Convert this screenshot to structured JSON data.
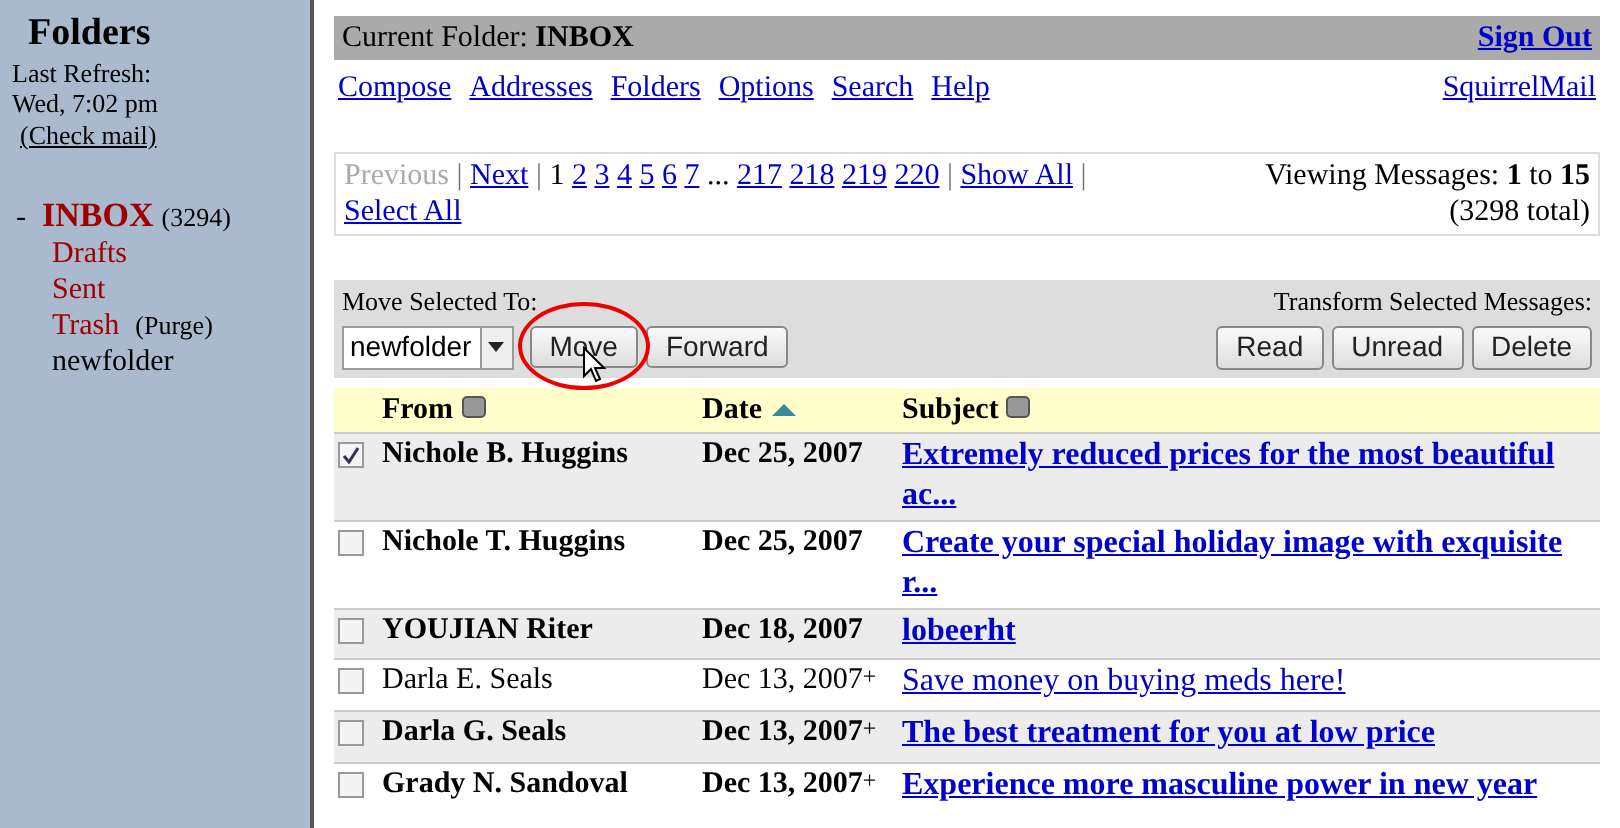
{
  "sidebar": {
    "title": "Folders",
    "refresh_label": "Last Refresh:",
    "refresh_time": "Wed, 7:02 pm",
    "check_mail": "(Check mail)",
    "folders": [
      {
        "expander": "-",
        "label": "INBOX",
        "count": "(3294)",
        "kind": "special",
        "selected": true
      },
      {
        "label": "Drafts",
        "kind": "special",
        "selected": false
      },
      {
        "label": "Sent",
        "kind": "special",
        "selected": false
      },
      {
        "label": "Trash",
        "action": "(Purge)",
        "kind": "special",
        "selected": false
      },
      {
        "label": "newfolder",
        "kind": "normal",
        "selected": false
      }
    ]
  },
  "header": {
    "folder_label": "Current Folder:",
    "folder": "INBOX",
    "sign_out": "Sign Out"
  },
  "nav": {
    "links": [
      "Compose",
      "Addresses",
      "Folders",
      "Options",
      "Search",
      "Help"
    ],
    "brand": "SquirrelMail"
  },
  "pager": {
    "items": [
      {
        "kind": "disabled",
        "text": "Previous"
      },
      {
        "kind": "sep",
        "text": "|"
      },
      {
        "kind": "link",
        "text": "Next"
      },
      {
        "kind": "sep",
        "text": "|"
      },
      {
        "kind": "current",
        "text": "1"
      },
      {
        "kind": "link",
        "text": "2"
      },
      {
        "kind": "link",
        "text": "3"
      },
      {
        "kind": "link",
        "text": "4"
      },
      {
        "kind": "link",
        "text": "5"
      },
      {
        "kind": "link",
        "text": "6"
      },
      {
        "kind": "link",
        "text": "7"
      },
      {
        "kind": "plain",
        "text": "..."
      },
      {
        "kind": "link",
        "text": "217"
      },
      {
        "kind": "link",
        "text": "218"
      },
      {
        "kind": "link",
        "text": "219"
      },
      {
        "kind": "link",
        "text": "220"
      },
      {
        "kind": "sep",
        "text": "|"
      },
      {
        "kind": "link",
        "text": "Show All"
      },
      {
        "kind": "sep",
        "text": "|"
      },
      {
        "kind": "link",
        "text": "Select All"
      }
    ],
    "viewing": "Viewing Messages: **1** to **15**",
    "total": "(3298 total)"
  },
  "actions": {
    "move_label": "Move Selected To:",
    "folder_select": "newfolder",
    "move_buttons": [
      "Move",
      "Forward"
    ],
    "transform_label": "Transform Selected Messages:",
    "transform_buttons": [
      "Read",
      "Unread",
      "Delete"
    ]
  },
  "table": {
    "columns": [
      {
        "label": "From",
        "sorted": false
      },
      {
        "label": "Date",
        "sorted": true
      },
      {
        "label": "Subject",
        "sorted": false
      }
    ],
    "rows": [
      {
        "checked": true,
        "unread": true,
        "from": "Nichole B. Huggins",
        "date": "Dec 25, 2007",
        "subject": "Extremely reduced prices for the most beautiful ac..."
      },
      {
        "checked": false,
        "unread": true,
        "from": "Nichole T. Huggins",
        "date": "Dec 25, 2007",
        "subject": "Create your special holiday image with exquisite r..."
      },
      {
        "checked": false,
        "unread": true,
        "from": "YOUJIAN Riter",
        "date": "Dec 18, 2007",
        "subject": "lobeerht"
      },
      {
        "checked": false,
        "unread": false,
        "from": "Darla E. Seals",
        "date": "Dec 13, 2007",
        "flag": "+",
        "subject": "Save money on buying meds here!"
      },
      {
        "checked": false,
        "unread": true,
        "from": "Darla G. Seals",
        "date": "Dec 13, 2007",
        "flag": "+",
        "subject": "The best treatment for you at low price"
      },
      {
        "checked": false,
        "unread": true,
        "from": "Grady N. Sandoval",
        "date": "Dec 13, 2007",
        "flag": "+",
        "subject": "Experience more masculine power in new year"
      }
    ]
  }
}
